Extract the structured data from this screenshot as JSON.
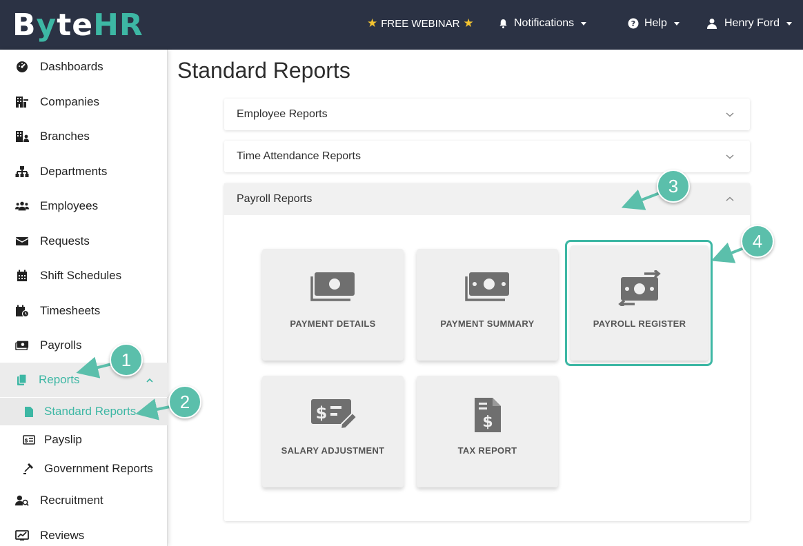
{
  "brand": {
    "logo_parts": [
      "B",
      "y",
      "te",
      "HR"
    ]
  },
  "topbar": {
    "webinar_label": "FREE WEBINAR",
    "notifications_label": "Notifications",
    "help_label": "Help",
    "user_label": "Henry Ford"
  },
  "sidebar": {
    "items": [
      {
        "label": "Dashboards",
        "icon": "dashboard-icon"
      },
      {
        "label": "Companies",
        "icon": "companies-icon"
      },
      {
        "label": "Branches",
        "icon": "branches-icon"
      },
      {
        "label": "Departments",
        "icon": "departments-icon"
      },
      {
        "label": "Employees",
        "icon": "employees-icon"
      },
      {
        "label": "Requests",
        "icon": "requests-icon"
      },
      {
        "label": "Shift Schedules",
        "icon": "calendar-icon"
      },
      {
        "label": "Timesheets",
        "icon": "timesheets-icon"
      },
      {
        "label": "Payrolls",
        "icon": "payrolls-icon"
      },
      {
        "label": "Reports",
        "icon": "reports-icon"
      },
      {
        "label": "Recruitment",
        "icon": "recruitment-icon"
      },
      {
        "label": "Reviews",
        "icon": "reviews-icon"
      }
    ],
    "reports_sub": [
      {
        "label": "Standard Reports",
        "icon": "file-icon"
      },
      {
        "label": "Payslip",
        "icon": "payslip-icon"
      },
      {
        "label": "Government Reports",
        "icon": "gavel-icon"
      }
    ]
  },
  "main": {
    "title": "Standard Reports",
    "panels": [
      {
        "label": "Employee Reports",
        "expanded": false
      },
      {
        "label": "Time Attendance Reports",
        "expanded": false
      },
      {
        "label": "Payroll Reports",
        "expanded": true
      }
    ],
    "cards": [
      {
        "label": "PAYMENT DETAILS",
        "icon": "money-stack-icon"
      },
      {
        "label": "PAYMENT SUMMARY",
        "icon": "money-stack-icon"
      },
      {
        "label": "PAYROLL REGISTER",
        "icon": "money-exchange-icon"
      },
      {
        "label": "SALARY ADJUSTMENT",
        "icon": "money-check-edit-icon"
      },
      {
        "label": "TAX REPORT",
        "icon": "file-invoice-dollar-icon"
      }
    ]
  },
  "annotations": [
    "1",
    "2",
    "3",
    "4"
  ],
  "colors": {
    "topbar_bg": "#2b3244",
    "accent": "#3db7a4",
    "badge": "#5bbfab",
    "card_bg": "#efefef"
  }
}
